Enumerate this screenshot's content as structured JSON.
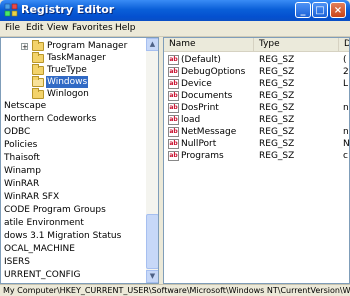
{
  "window": {
    "title": "Registry Editor"
  },
  "menu": [
    "File",
    "Edit",
    "View",
    "Favorites",
    "Help"
  ],
  "tree": {
    "items": [
      {
        "label": "Program Manager",
        "indent": 2,
        "expand": "+"
      },
      {
        "label": "TaskManager",
        "indent": 2,
        "expand": ""
      },
      {
        "label": "TrueType",
        "indent": 2,
        "expand": ""
      },
      {
        "label": "Windows",
        "indent": 2,
        "expand": "",
        "selected": true
      },
      {
        "label": "Winlogon",
        "indent": 2,
        "expand": ""
      },
      {
        "label": "Netscape",
        "indent": 0
      },
      {
        "label": "Northern Codeworks",
        "indent": 0
      },
      {
        "label": "ODBC",
        "indent": 0
      },
      {
        "label": "Policies",
        "indent": 0
      },
      {
        "label": "Thaisoft",
        "indent": 0
      },
      {
        "label": "Winamp",
        "indent": 0
      },
      {
        "label": "WinRAR",
        "indent": 0
      },
      {
        "label": "WinRAR SFX",
        "indent": 0
      },
      {
        "label": "CODE Program Groups",
        "indent": 0
      },
      {
        "label": "atile Environment",
        "indent": 0
      },
      {
        "label": "dows 3.1 Migration Status",
        "indent": 0
      },
      {
        "label": "OCAL_MACHINE",
        "indent": 0
      },
      {
        "label": "ISERS",
        "indent": 0
      },
      {
        "label": "URRENT_CONFIG",
        "indent": 0
      }
    ]
  },
  "list": {
    "columns": [
      "Name",
      "Type",
      "D"
    ],
    "rows": [
      {
        "name": "(Default)",
        "type": "REG_SZ",
        "data": "("
      },
      {
        "name": "DebugOptions",
        "type": "REG_SZ",
        "data": "2"
      },
      {
        "name": "Device",
        "type": "REG_SZ",
        "data": "L"
      },
      {
        "name": "Documents",
        "type": "REG_SZ",
        "data": ""
      },
      {
        "name": "DosPrint",
        "type": "REG_SZ",
        "data": "n"
      },
      {
        "name": "load",
        "type": "REG_SZ",
        "data": ""
      },
      {
        "name": "NetMessage",
        "type": "REG_SZ",
        "data": "n"
      },
      {
        "name": "NullPort",
        "type": "REG_SZ",
        "data": "N"
      },
      {
        "name": "Programs",
        "type": "REG_SZ",
        "data": "c"
      }
    ]
  },
  "status": {
    "path": "My Computer\\HKEY_CURRENT_USER\\Software\\Microsoft\\Windows NT\\CurrentVersion\\Windows"
  },
  "icons": {
    "value_icon_text": "ab"
  }
}
